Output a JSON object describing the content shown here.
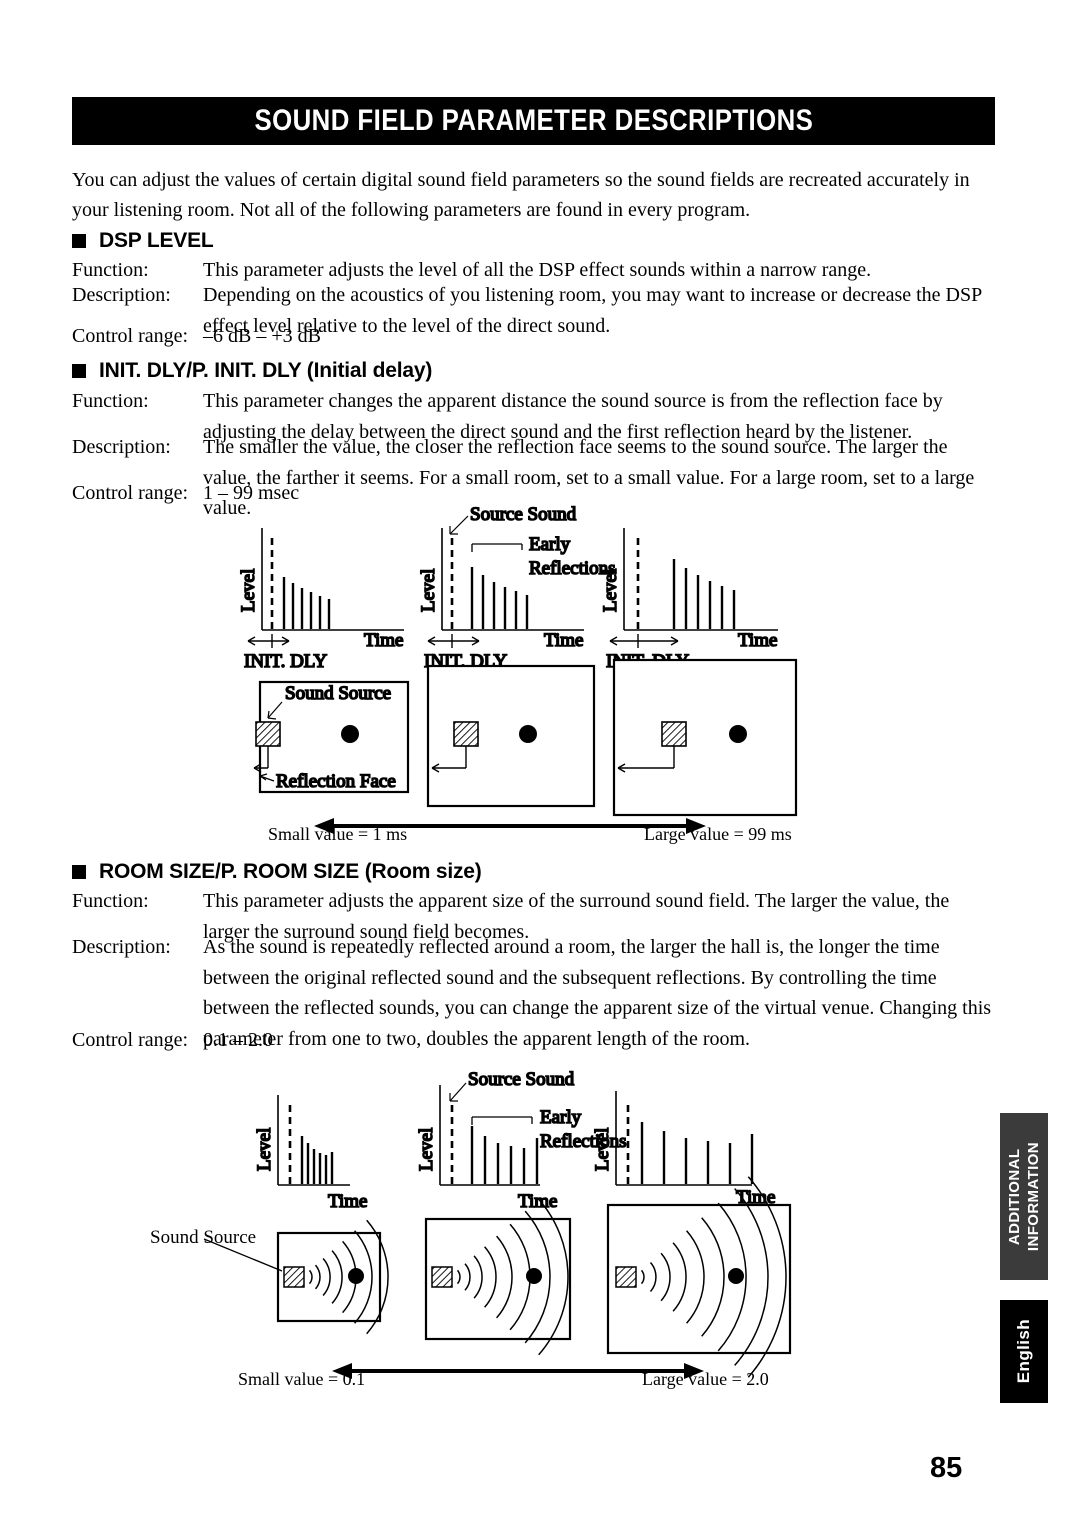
{
  "banner": {
    "title": "SOUND FIELD PARAMETER DESCRIPTIONS"
  },
  "intro": "You can adjust the values of certain digital sound field parameters so the sound fields are recreated accurately in your listening room. Not all of the following parameters are found in every program.",
  "labels": {
    "function": "Function:",
    "description": "Description:",
    "control_range": "Control range:"
  },
  "sections": [
    {
      "heading": "DSP LEVEL",
      "function": "This parameter adjusts the level of all the DSP effect sounds within a narrow range.",
      "description": "Depending on the acoustics of you listening room, you may want to increase or decrease the DSP effect level relative to the level of the direct sound.",
      "control_range": "–6 dB – +3 dB"
    },
    {
      "heading": "INIT. DLY/P. INIT. DLY (Initial delay)",
      "function": "This parameter changes the apparent distance the sound source is from the reflection face by adjusting the delay between the direct sound and the first reflection heard by the listener.",
      "description": "The smaller the value, the closer the reflection face seems to the sound source. The larger the value, the farther it seems. For a small room, set to a small value. For a large room, set to a large value.",
      "control_range": "1 – 99 msec"
    },
    {
      "heading": "ROOM SIZE/P. ROOM SIZE (Room size)",
      "function": "This parameter adjusts the apparent size of the surround sound field. The larger the value, the larger the surround sound field becomes.",
      "description": "As the sound is repeatedly reflected around a room, the larger the hall is, the longer the time between the original reflected sound and the subsequent reflections. By controlling the time between the reflected sounds, you can change the apparent size of the virtual venue. Changing this parameter from one to two, doubles the apparent length of the room.",
      "control_range": "0.1 – 2.0"
    }
  ],
  "figure_init_dly": {
    "axis_level": "Level",
    "axis_time": "Time",
    "init_dly_label": "INIT. DLY",
    "source_sound_label": "Source Sound",
    "early_reflections_line1": "Early",
    "early_reflections_line2": "Reflections",
    "sound_source_label": "Sound Source",
    "reflection_face_label": "Reflection Face",
    "small_value": "Small value = 1 ms",
    "large_value": "Large value = 99 ms",
    "graphs": [
      {
        "dly": 1,
        "bars": [
          52,
          46,
          41,
          37,
          33,
          30
        ]
      },
      {
        "dly": 6,
        "bars": [
          62,
          54,
          47,
          42,
          38,
          34
        ]
      },
      {
        "dly": 14,
        "bars": [
          70,
          61,
          54,
          48,
          43,
          39
        ]
      }
    ]
  },
  "figure_room_size": {
    "axis_level": "Level",
    "axis_time": "Time",
    "source_sound_label": "Source Sound",
    "early_reflections_line1": "Early",
    "early_reflections_line2": "Reflections",
    "sound_source_label": "Sound Source",
    "small_value": "Small value = 0.1",
    "large_value": "Large value = 2.0",
    "graphs": [
      {
        "spacing": 6,
        "bars": [
          48,
          41,
          35,
          31,
          29,
          32
        ]
      },
      {
        "spacing": 13,
        "bars": [
          58,
          48,
          41,
          38,
          36,
          46
        ]
      },
      {
        "spacing": 22,
        "bars": [
          62,
          53,
          46,
          43,
          41,
          50
        ]
      }
    ]
  },
  "side_tabs": {
    "additional_line1": "ADDITIONAL",
    "additional_line2": "INFORMATION",
    "english": "English"
  },
  "page_number": "85"
}
